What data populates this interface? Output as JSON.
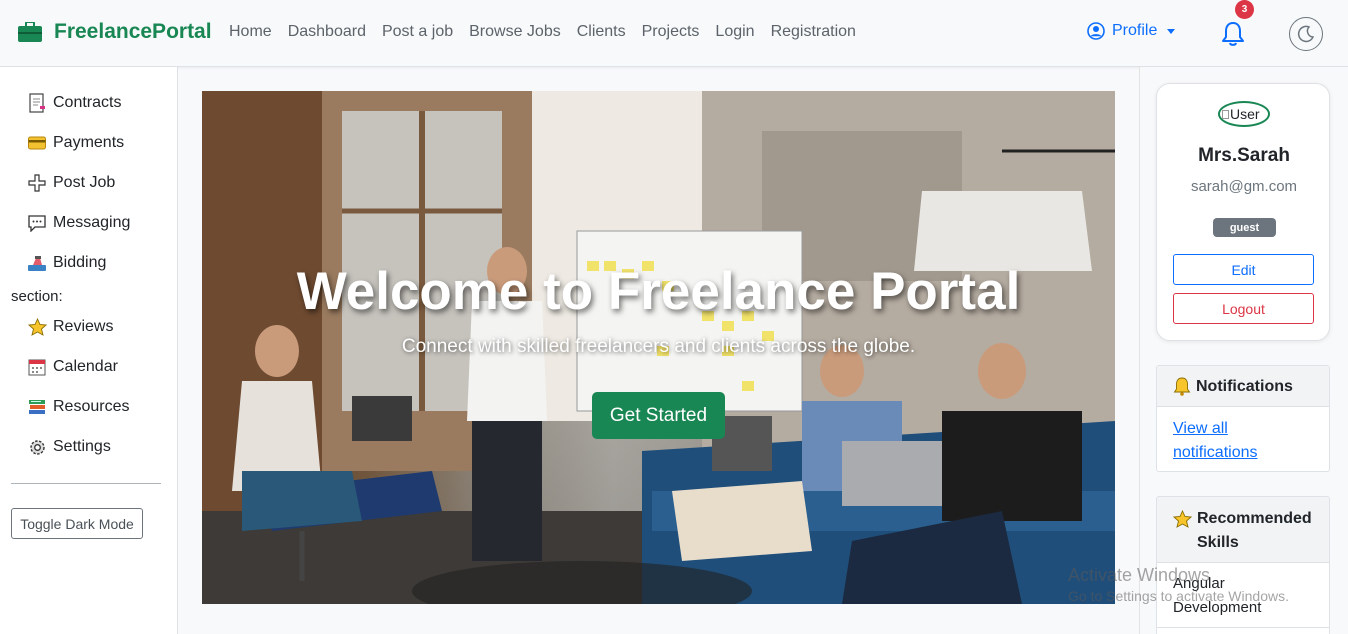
{
  "navbar": {
    "brand": "FreelancePortal",
    "links": [
      "Home",
      "Dashboard",
      "Post a job",
      "Browse Jobs",
      "Clients",
      "Projects",
      "Login",
      "Registration"
    ],
    "profile_label": "Profile",
    "notification_count": "3",
    "brand_color": "#198754",
    "accent_color": "#0d6efd"
  },
  "sidebar": {
    "items": [
      {
        "label": "Contracts",
        "icon": "contract-icon"
      },
      {
        "label": "Payments",
        "icon": "credit-card-icon"
      },
      {
        "label": "Post Job",
        "icon": "plus-icon"
      },
      {
        "label": "Messaging",
        "icon": "chat-bubble-icon"
      },
      {
        "label": "Bidding",
        "icon": "bid-icon"
      },
      {
        "label": "Reviews",
        "icon": "star-icon"
      },
      {
        "label": "Calendar",
        "icon": "calendar-icon"
      },
      {
        "label": "Resources",
        "icon": "books-icon"
      },
      {
        "label": "Settings",
        "icon": "gear-icon"
      }
    ],
    "section_text": "section:",
    "toggle_label": "Toggle Dark Mode"
  },
  "hero": {
    "title": "Welcome to Freelance Portal",
    "subtitle": "Connect with skilled freelancers and clients across the globe.",
    "cta_label": "Get Started"
  },
  "profile_card": {
    "avatar_alt": "User",
    "name": "Mrs.Sarah",
    "email": "sarah@gm.com",
    "role": "guest",
    "edit_label": "Edit",
    "logout_label": "Logout"
  },
  "notifications_card": {
    "title": "Notifications",
    "link": "View all notifications"
  },
  "skills_card": {
    "title": "Recommended Skills",
    "items": [
      "Angular Development"
    ]
  },
  "watermark": {
    "line1": "Activate Windows",
    "line2": "Go to Settings to activate Windows."
  }
}
